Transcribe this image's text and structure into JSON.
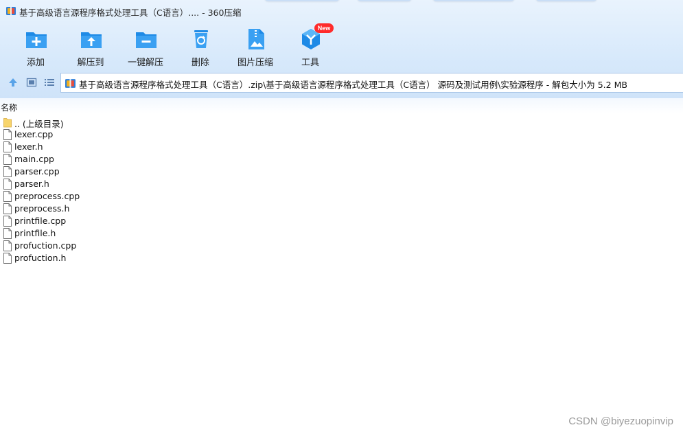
{
  "window": {
    "title": "基于高级语言源程序格式处理工具（C语言）.... - 360压缩"
  },
  "toolbar": {
    "items": [
      {
        "label": "添加",
        "icon": "add-folder-icon"
      },
      {
        "label": "解压到",
        "icon": "extract-to-icon"
      },
      {
        "label": "一键解压",
        "icon": "one-click-extract-icon"
      },
      {
        "label": "删除",
        "icon": "recycle-bin-icon"
      },
      {
        "label": "图片压缩",
        "icon": "image-compress-icon"
      },
      {
        "label": "工具",
        "icon": "tools-icon",
        "badge": "New"
      }
    ]
  },
  "nav": {
    "up": "up-arrow-icon",
    "thumbnail_view": "thumbnail-view-icon",
    "list_view": "list-view-icon"
  },
  "address": {
    "path": "基于高级语言源程序格式处理工具（C语言）.zip\\基于高级语言源程序格式处理工具（C语言） 源码及测试用例\\实验源程序 - 解包大小为 5.2 MB"
  },
  "list": {
    "column_name": "名称",
    "items": [
      {
        "name": ".. (上级目录)",
        "type": "folder"
      },
      {
        "name": "lexer.cpp",
        "type": "file"
      },
      {
        "name": "lexer.h",
        "type": "file"
      },
      {
        "name": "main.cpp",
        "type": "file"
      },
      {
        "name": "parser.cpp",
        "type": "file"
      },
      {
        "name": "parser.h",
        "type": "file"
      },
      {
        "name": "preprocess.cpp",
        "type": "file"
      },
      {
        "name": "preprocess.h",
        "type": "file"
      },
      {
        "name": "printfile.cpp",
        "type": "file"
      },
      {
        "name": "printfile.h",
        "type": "file"
      },
      {
        "name": "profuction.cpp",
        "type": "file"
      },
      {
        "name": "profuction.h",
        "type": "file"
      }
    ]
  },
  "watermark": "CSDN @biyezuopinvip",
  "colors": {
    "accent": "#2b8fe6",
    "toolbar_bg": "#d7e9fb",
    "badge": "#ff2b2b"
  }
}
